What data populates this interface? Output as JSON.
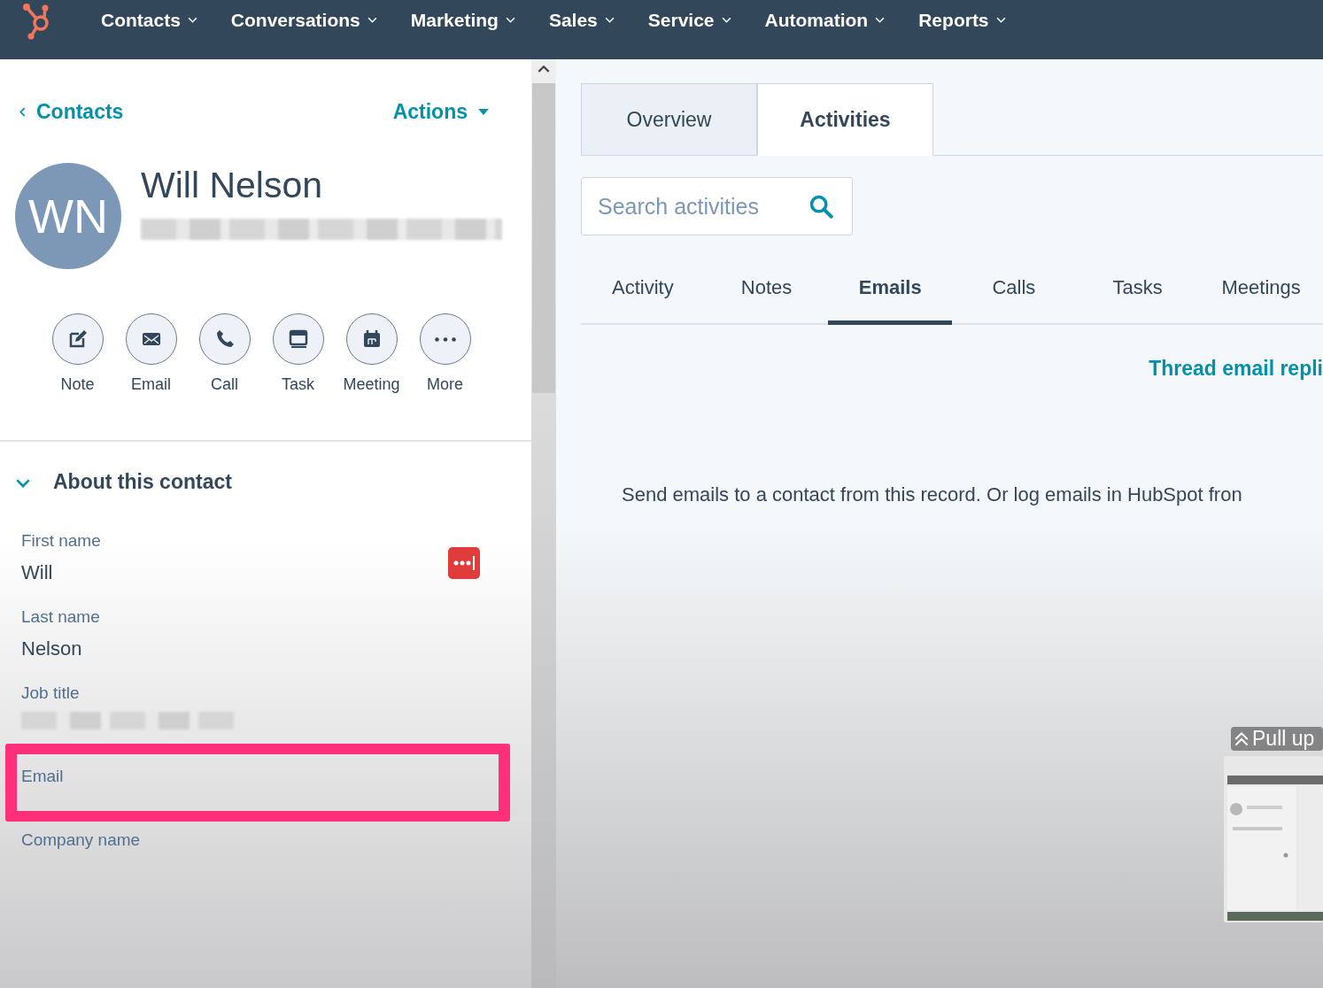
{
  "nav": {
    "items": [
      {
        "label": "Contacts"
      },
      {
        "label": "Conversations"
      },
      {
        "label": "Marketing"
      },
      {
        "label": "Sales"
      },
      {
        "label": "Service"
      },
      {
        "label": "Automation"
      },
      {
        "label": "Reports"
      }
    ]
  },
  "sidebar": {
    "back_link": "Contacts",
    "actions": "Actions",
    "contact": {
      "initials": "WN",
      "name": "Will Nelson",
      "subtitle_blurred": true
    },
    "quick_actions": [
      {
        "kind": "note",
        "label": "Note"
      },
      {
        "kind": "email",
        "label": "Email"
      },
      {
        "kind": "call",
        "label": "Call"
      },
      {
        "kind": "task",
        "label": "Task"
      },
      {
        "kind": "meeting",
        "label": "Meeting"
      },
      {
        "kind": "more",
        "label": "More"
      }
    ],
    "section": {
      "title": "About this contact",
      "expanded": true
    },
    "fields": [
      {
        "label": "First name",
        "value": "Will",
        "autofill_icon": true,
        "highlighted": false
      },
      {
        "label": "Last name",
        "value": "Nelson",
        "autofill_icon": false,
        "highlighted": false
      },
      {
        "label": "Job title",
        "blurred": true,
        "autofill_icon": false,
        "highlighted": false
      },
      {
        "label": "Email",
        "autofill_icon": false,
        "highlighted": true
      },
      {
        "label": "Company name",
        "autofill_icon": false,
        "highlighted": false
      }
    ]
  },
  "tabs": [
    {
      "label": "Overview",
      "selected": false
    },
    {
      "label": "Activities",
      "selected": true
    }
  ],
  "search": {
    "placeholder": "Search activities"
  },
  "filters": [
    {
      "label": "Activity",
      "selected": false
    },
    {
      "label": "Notes",
      "selected": false
    },
    {
      "label": "Emails",
      "selected": true
    },
    {
      "label": "Calls",
      "selected": false
    },
    {
      "label": "Tasks",
      "selected": false
    },
    {
      "label": "Meetings",
      "selected": false
    }
  ],
  "thread_link": "Thread email repli",
  "empty_message": "Send emails to a contact from this record. Or log emails in HubSpot fron",
  "overlay": {
    "hint": "Pull up"
  }
}
